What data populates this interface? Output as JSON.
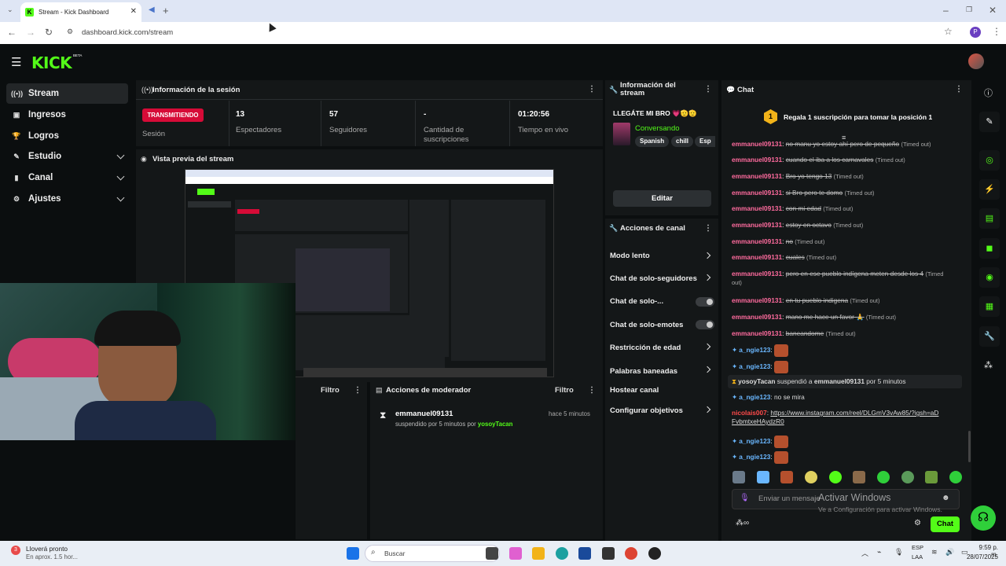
{
  "browser": {
    "tab_title": "Stream - Kick Dashboard",
    "url": "dashboard.kick.com/stream",
    "profile_initial": "P"
  },
  "app": {
    "logo": "KICK",
    "beta": "BETA"
  },
  "sidebar": {
    "items": [
      {
        "label": "Stream",
        "icon": "radio-icon",
        "active": true
      },
      {
        "label": "Ingresos",
        "icon": "dollar-icon"
      },
      {
        "label": "Logros",
        "icon": "trophy-icon"
      },
      {
        "label": "Estudio",
        "icon": "pen-icon",
        "chevron": true
      },
      {
        "label": "Canal",
        "icon": "bookmark-icon",
        "chevron": true
      },
      {
        "label": "Ajustes",
        "icon": "gear-icon",
        "chevron": true
      }
    ]
  },
  "session": {
    "title": "Información de la sesión",
    "status": "TRANSMITIENDO",
    "status_label": "Sesión",
    "metrics": [
      {
        "value": "13",
        "label": "Espectadores"
      },
      {
        "value": "57",
        "label": "Seguidores"
      },
      {
        "value": "-",
        "label": "Cantidad de suscripciones"
      },
      {
        "value": "01:20:56",
        "label": "Tiempo en vivo"
      }
    ]
  },
  "preview": {
    "title": "Vista previa del stream"
  },
  "bottom": {
    "filter_label": "Filtro",
    "mod_title": "Acciones de moderador",
    "mod_filter": "Filtro",
    "mod_user": "emmanuel09131",
    "mod_time": "hace 5 minutos",
    "mod_text": "suspendido por 5 minutos por ",
    "mod_by": "yosoyTacan"
  },
  "stream_info": {
    "title": "Información del stream",
    "stream_title": "LLEGÁTE MI BRO 💗🫡🫡",
    "category": "Conversando",
    "tags": [
      "Spanish",
      "chill",
      "Esp"
    ],
    "edit": "Editar"
  },
  "channel_actions": {
    "title": "Acciones de canal",
    "items": [
      {
        "label": "Modo lento",
        "type": "arrow"
      },
      {
        "label": "Chat de solo-seguidores",
        "type": "arrow"
      },
      {
        "label": "Chat de solo-...",
        "type": "toggle"
      },
      {
        "label": "Chat de solo-emotes",
        "type": "toggle"
      },
      {
        "label": "Restricción de edad",
        "type": "arrow"
      },
      {
        "label": "Palabras baneadas",
        "type": "arrow"
      },
      {
        "label": "Hostear canal",
        "type": "none"
      },
      {
        "label": "Configurar objetivos",
        "type": "arrow"
      }
    ]
  },
  "chat": {
    "title": "Chat",
    "gift_rank": "1",
    "gift_text": "Regala 1 suscripción para tomar la posición 1",
    "timed_out_label": "(Timed out)",
    "lines": [
      {
        "user": "emmanuel09131",
        "msg": "no manu yo estoy ahí pero de pequeño"
      },
      {
        "user": "emmanuel09131",
        "msg": "cuando el iba a los carnavales"
      },
      {
        "user": "emmanuel09131",
        "msg": "Bro yo tengo 13"
      },
      {
        "user": "emmanuel09131",
        "msg": "si Bro pero te domo"
      },
      {
        "user": "emmanuel09131",
        "msg": "con mi edad"
      },
      {
        "user": "emmanuel09131",
        "msg": "estoy en octavo"
      },
      {
        "user": "emmanuel09131",
        "msg": "no"
      },
      {
        "user": "emmanuel09131",
        "msg": "cuales"
      },
      {
        "user": "emmanuel09131",
        "msg": "pero en ese pueblo indígena meten desde los 4"
      },
      {
        "user": "emmanuel09131",
        "msg": "en tu pueblo indigena"
      },
      {
        "user": "emmanuel09131",
        "msg": "mano me hace un favor 🙏"
      },
      {
        "user": "emmanuel09131",
        "msg": "baneandome"
      }
    ],
    "a_user": "a_ngie123",
    "suspend_actor": "yosoyTacan",
    "suspend_text": " suspendió a ",
    "suspend_target": "emmanuel09131",
    "suspend_tail": " por 5 minutos",
    "angie_msg": "no se mira",
    "nicolais_user": "nicolais007",
    "nicolais_link": "https://www.instagram.com/reel/DLGmV3vAw85/?igsh=aDFvbmtxeHAydzR0",
    "input_placeholder": "Enviar un mensaje",
    "send_label": "Chat"
  },
  "watermark": {
    "title": "Activar Windows",
    "subtitle": "Ve a Configuración para activar Windows."
  },
  "taskbar": {
    "weather_title": "Lloverá pronto",
    "weather_sub": "En aprox. 1.5 hor...",
    "search": "Buscar",
    "lang1": "ESP",
    "lang2": "LAA",
    "time": "9:59 p. m.",
    "date": "28/07/2025"
  }
}
